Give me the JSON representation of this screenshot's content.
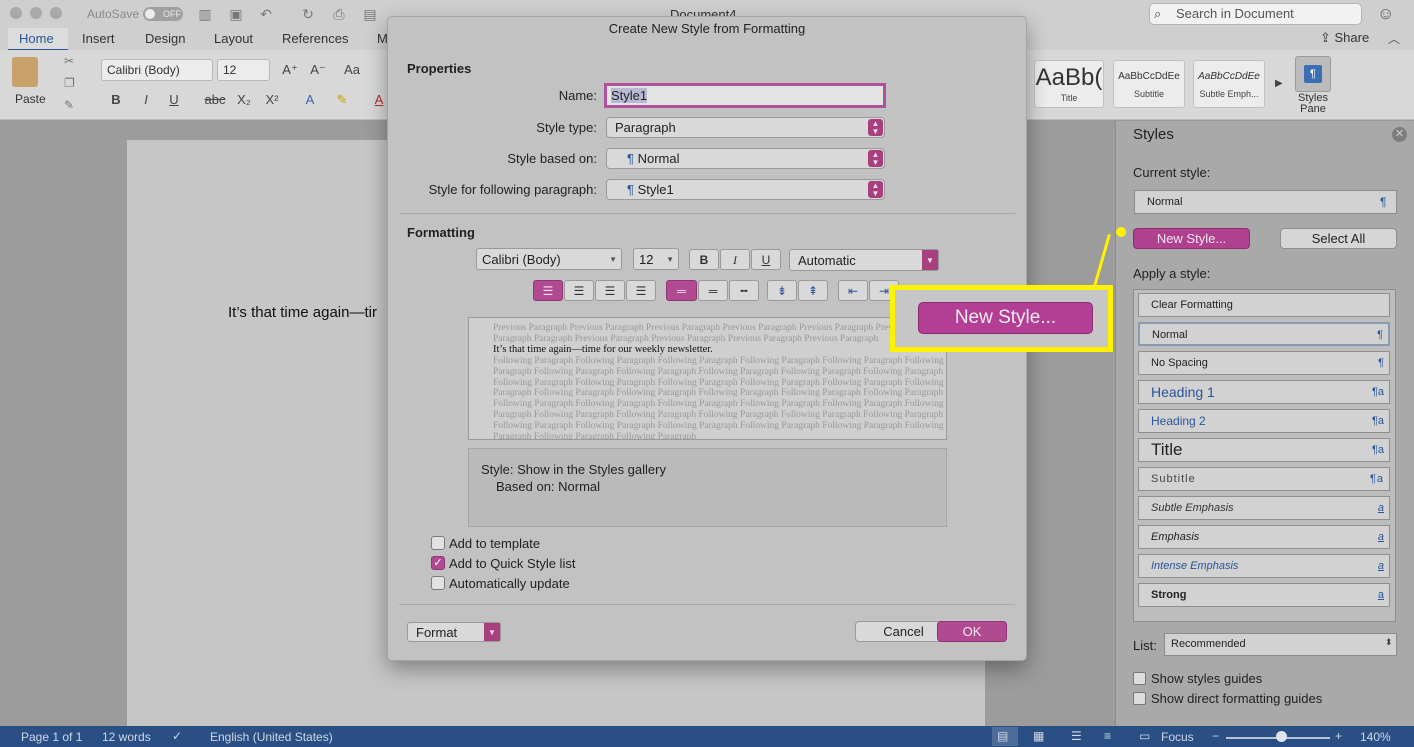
{
  "titlebar": {
    "autosave_label": "AutoSave",
    "autosave_state": "OFF",
    "document_title": "Document4",
    "search_placeholder": "Search in Document"
  },
  "ribbon": {
    "tabs": [
      "Home",
      "Insert",
      "Design",
      "Layout",
      "References",
      "M"
    ],
    "active_tab": "Home",
    "share_label": "Share",
    "paste_label": "Paste",
    "font_name": "Calibri (Body)",
    "font_size": "12",
    "style_gallery": [
      {
        "sample": "AaBb(",
        "caption": "Title"
      },
      {
        "sample": "AaBbCcDdEe",
        "caption": "Subtitle"
      },
      {
        "sample": "AaBbCcDdEe",
        "caption": "Subtle Emph..."
      }
    ],
    "styles_pane_label": "Styles Pane"
  },
  "document": {
    "body_text": "It’s that time again—tir"
  },
  "dialog": {
    "title": "Create New Style from Formatting",
    "properties_heading": "Properties",
    "name_label": "Name:",
    "name_value": "Style1",
    "style_type_label": "Style type:",
    "style_type_value": "Paragraph",
    "based_on_label": "Style based on:",
    "based_on_value": "Normal",
    "following_label": "Style for following paragraph:",
    "following_value": "Style1",
    "formatting_heading": "Formatting",
    "font_value": "Calibri (Body)",
    "size_value": "12",
    "bold_label": "B",
    "italic_label": "I",
    "underline_label": "U",
    "color_value": "Automatic",
    "preview": {
      "previous": "Previous Paragraph Previous Paragraph Previous Paragraph Previous Paragraph Previous Paragraph Previous Paragraph Paragraph Previous Paragraph Previous Paragraph Previous Paragraph Previous Paragraph",
      "current": "It’s that time again—time for our weekly newsletter.",
      "following": "Following Paragraph Following Paragraph Following Paragraph Following Paragraph Following Paragraph Following Paragraph Following Paragraph Following Paragraph Following Paragraph Following Paragraph Following Paragraph Following Paragraph Following Paragraph Following Paragraph Following Paragraph Following Paragraph Following Paragraph Following Paragraph Following Paragraph Following Paragraph Following Paragraph Following Paragraph Following Paragraph Following Paragraph Following Paragraph Following Paragraph Following Paragraph Following Paragraph Following Paragraph Following Paragraph Following Paragraph Following Paragraph Following Paragraph Following Paragraph Following Paragraph Following Paragraph Following Paragraph Following Paragraph Following Paragraph Following Paragraph Following Paragraph"
    },
    "description_line1": "Style: Show in the Styles gallery",
    "description_line2": "Based on: Normal",
    "add_to_template": "Add to template",
    "add_to_quick_style": "Add to Quick Style list",
    "auto_update": "Automatically update",
    "format_menu": "Format",
    "cancel_label": "Cancel",
    "ok_label": "OK"
  },
  "callout": {
    "label": "New Style..."
  },
  "styles_pane": {
    "title": "Styles",
    "current_style_label": "Current style:",
    "current_style_value": "Normal",
    "new_style_label": "New Style...",
    "select_all_label": "Select All",
    "apply_label": "Apply a style:",
    "styles": [
      {
        "name": "Clear Formatting",
        "mark": ""
      },
      {
        "name": "Normal",
        "mark": "¶"
      },
      {
        "name": "No Spacing",
        "mark": "¶"
      },
      {
        "name": "Heading 1",
        "mark": "¶a"
      },
      {
        "name": "Heading 2",
        "mark": "¶a"
      },
      {
        "name": "Title",
        "mark": "¶a"
      },
      {
        "name": "Subtitle",
        "mark": "¶a"
      },
      {
        "name": "Subtle Emphasis",
        "mark": "a"
      },
      {
        "name": "Emphasis",
        "mark": "a"
      },
      {
        "name": "Intense Emphasis",
        "mark": "a"
      },
      {
        "name": "Strong",
        "mark": "a"
      }
    ],
    "list_label": "List:",
    "list_value": "Recommended",
    "show_guides": "Show styles guides",
    "show_direct": "Show direct formatting guides"
  },
  "statusbar": {
    "page": "Page 1 of 1",
    "words": "12 words",
    "language": "English (United States)",
    "focus": "Focus",
    "zoom": "140%"
  },
  "colors": {
    "accent": "#b04a91",
    "callout": "#fff200",
    "statusbar": "#2a4f84"
  }
}
